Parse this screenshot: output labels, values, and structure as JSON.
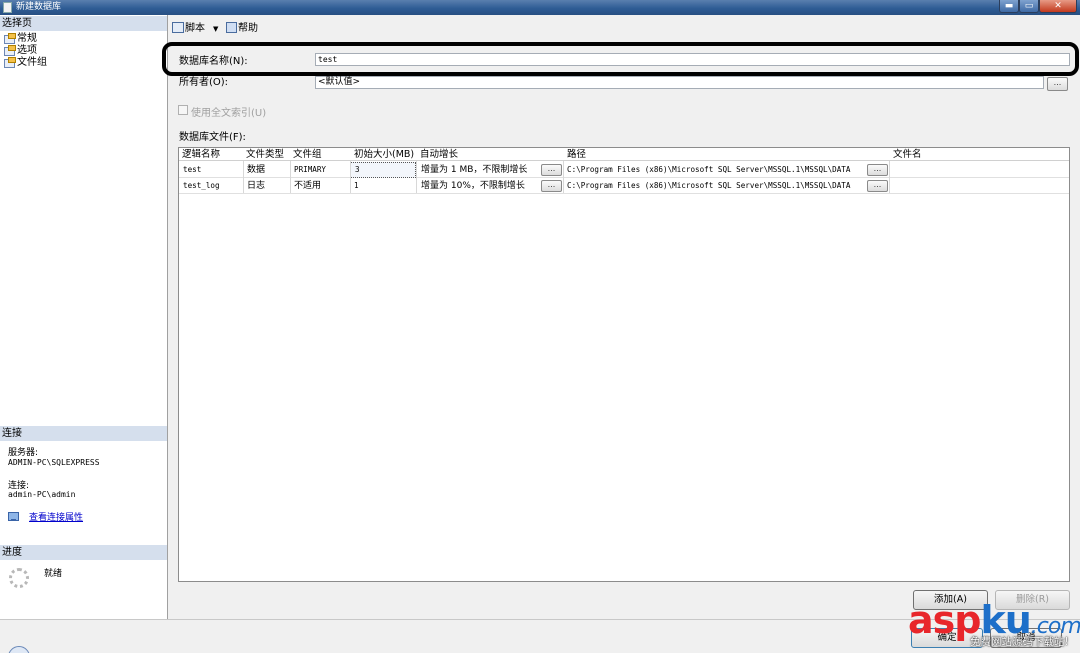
{
  "window": {
    "title": "新建数据库",
    "minimize": "▬",
    "maximize": "▭",
    "close": "✕"
  },
  "left_pane": {
    "select_page_header": "选择页",
    "pages": [
      "常规",
      "选项",
      "文件组"
    ],
    "connection_header": "连接",
    "server_label": "服务器:",
    "server_value": "ADMIN-PC\\SQLEXPRESS",
    "connection_label": "连接:",
    "connection_value": "admin-PC\\admin",
    "view_connection_link": "查看连接属性",
    "progress_header": "进度",
    "progress_status": "就绪"
  },
  "toolbar": {
    "script_label": "脚本",
    "script_arrow": "▼",
    "help_label": "帮助"
  },
  "form": {
    "db_name_label": "数据库名称(N):",
    "db_name_value": "test",
    "owner_label": "所有者(O):",
    "owner_value": "<默认值>",
    "browse_label": "...",
    "fulltext_label": "使用全文索引(U)",
    "files_label": "数据库文件(F):"
  },
  "grid": {
    "columns": [
      "逻辑名称",
      "文件类型",
      "文件组",
      "初始大小(MB)",
      "自动增长",
      "路径",
      "文件名"
    ],
    "rows": [
      {
        "logical_name": "test",
        "file_type": "数据",
        "filegroup": "PRIMARY",
        "initial_size": "3",
        "autogrowth": "增量为 1 MB，不限制增长",
        "autogrowth_btn": "...",
        "path": "C:\\Program Files (x86)\\Microsoft SQL Server\\MSSQL.1\\MSSQL\\DATA",
        "path_btn": "...",
        "file_name": ""
      },
      {
        "logical_name": "test_log",
        "file_type": "日志",
        "filegroup": "不适用",
        "initial_size": "1",
        "autogrowth": "增量为 10%，不限制增长",
        "autogrowth_btn": "...",
        "path": "C:\\Program Files (x86)\\Microsoft SQL Server\\MSSQL.1\\MSSQL\\DATA",
        "path_btn": "...",
        "file_name": ""
      }
    ]
  },
  "buttons": {
    "add": "添加(A)",
    "remove": "删除(R)",
    "ok": "确定",
    "cancel": "取消"
  },
  "watermark": {
    "asp": "asp",
    "ku": "ku",
    "com": ".com",
    "sub": "免费网站源码下载站!"
  }
}
